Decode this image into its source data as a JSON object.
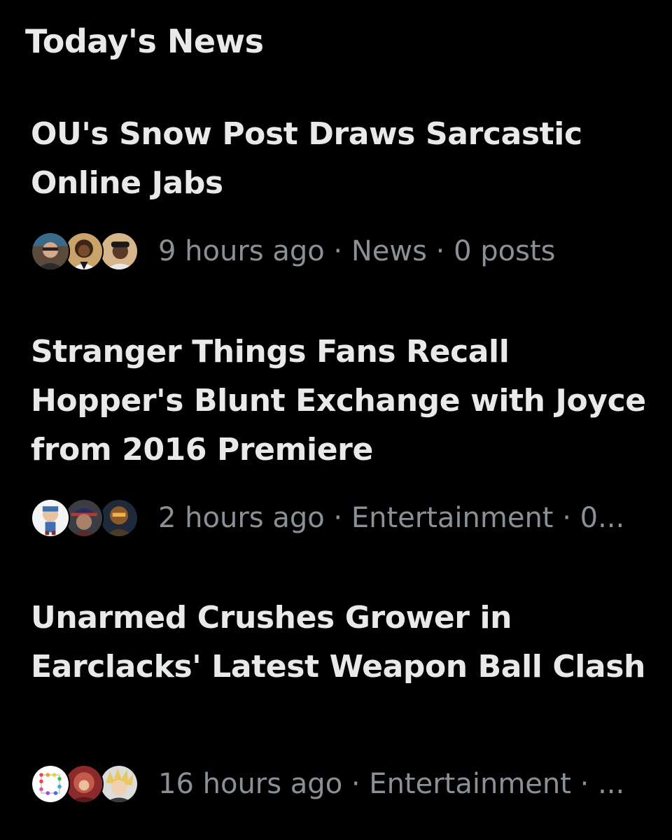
{
  "section": {
    "title": "Today's News"
  },
  "news": [
    {
      "headline": "OU's Snow Post Draws Sarcastic Online Jabs",
      "meta": "9 hours ago · News · 0 posts",
      "avatars": [
        "man-with-sunglasses-avatar",
        "animated-woman-avatar",
        "man-with-cap-avatar"
      ]
    },
    {
      "headline": "Stranger Things Fans Recall Hopper's Blunt Exchange with Joyce from 2016 Premiere",
      "meta": "2 hours ago · Entertainment · 0...",
      "avatars": [
        "figurine-avatar",
        "hat-figure-avatar",
        "robot-avatar"
      ]
    },
    {
      "headline": "Unarmed Crushes Grower in Earclacks' Latest Weapon Ball Clash",
      "meta": "16 hours ago · Entertainment · ...",
      "avatars": [
        "square-dots-avatar",
        "red-figure-avatar",
        "spiky-hair-avatar"
      ]
    }
  ],
  "colors": {
    "background": "#000000",
    "headline": "#e7e9ea",
    "meta": "#8b9096"
  }
}
